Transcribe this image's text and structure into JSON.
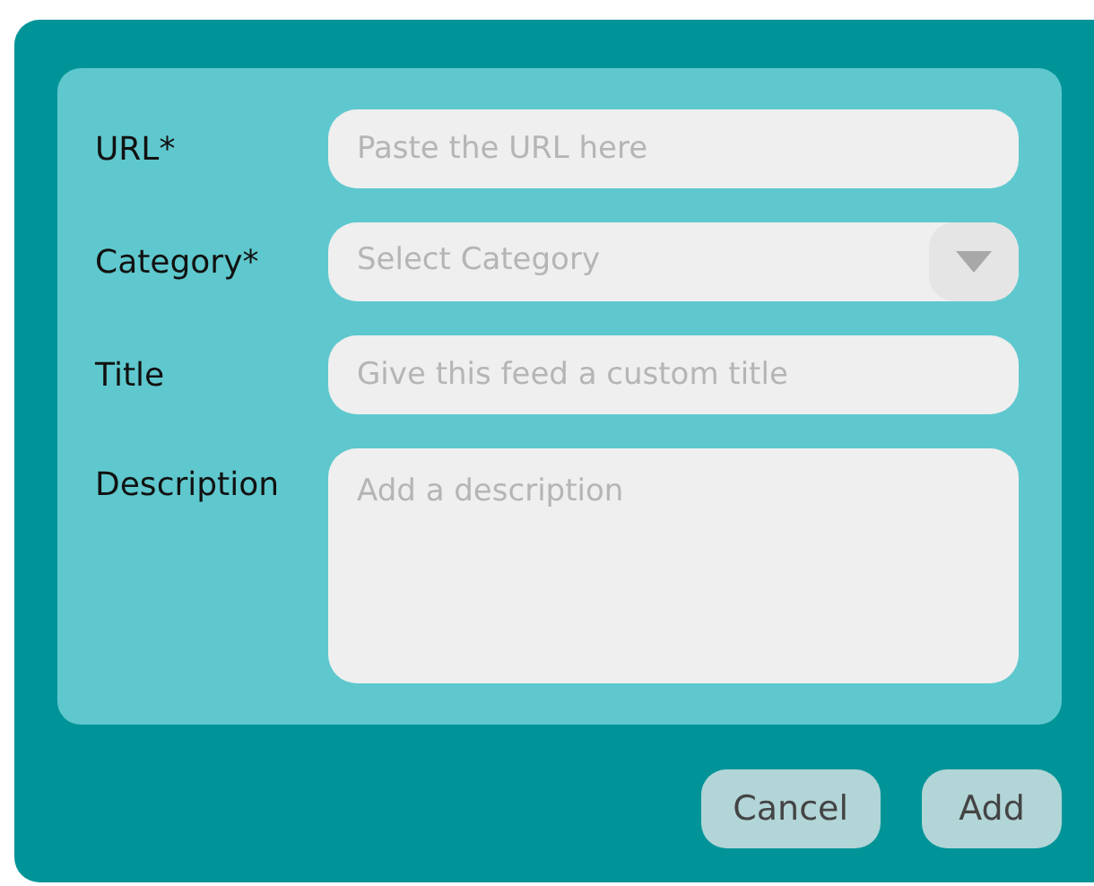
{
  "fields": [
    {
      "kind": "text",
      "label": "URL*",
      "placeholder": "Paste the URL here"
    },
    {
      "kind": "select",
      "label": "Category*",
      "placeholder": "Select Category"
    },
    {
      "kind": "text",
      "label": "Title",
      "placeholder": "Give this feed a custom title"
    },
    {
      "kind": "textarea",
      "label": "Description",
      "placeholder": "Add a description"
    }
  ],
  "buttons": [
    "Cancel",
    "Add"
  ]
}
